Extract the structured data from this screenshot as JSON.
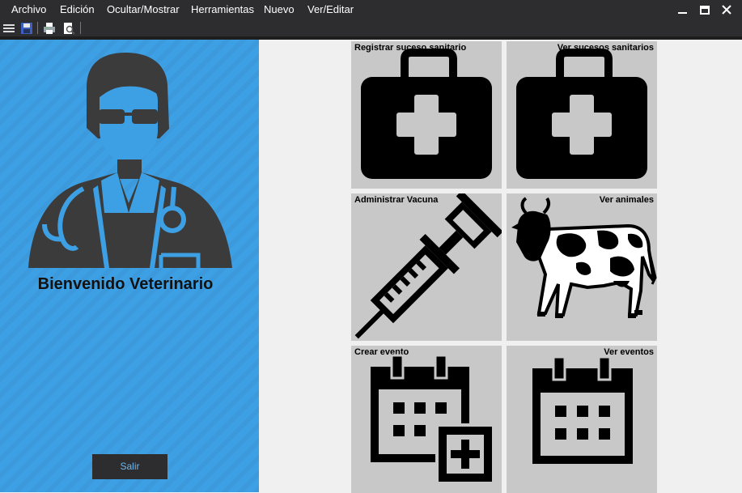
{
  "menu": {
    "items": [
      "Archivo",
      "Edición",
      "Ocultar/Mostrar",
      "Herramientas",
      "Nuevo",
      "Ver/Editar"
    ]
  },
  "window_controls": [
    "minimize-icon",
    "maximize-icon",
    "close-icon"
  ],
  "toolbar": {
    "icons": [
      "hamburger-menu-icon",
      "save-icon",
      "print-icon",
      "print-preview-icon"
    ]
  },
  "sidebar": {
    "avatar_icon": "doctor-avatar-icon",
    "welcome": "Bienvenido Veterinario",
    "exit_button": "Salir"
  },
  "tiles": [
    {
      "label": "Registrar suceso sanitario",
      "icon": "medical-kit-icon"
    },
    {
      "label": "Ver sucesos sanitarios",
      "icon": "medical-kit-icon"
    },
    {
      "label": "Administrar Vacuna",
      "icon": "syringe-icon"
    },
    {
      "label": "Ver animales",
      "icon": "cow-icon"
    },
    {
      "label": "Crear evento",
      "icon": "calendar-add-icon"
    },
    {
      "label": "Ver eventos",
      "icon": "calendar-icon"
    }
  ],
  "colors": {
    "menubar": "#2d2d30",
    "sidebar": "#3ea0e4",
    "tile": "#c8c8c8",
    "content_bg": "#f0f0f0",
    "exit_text": "#6fb7ea"
  }
}
